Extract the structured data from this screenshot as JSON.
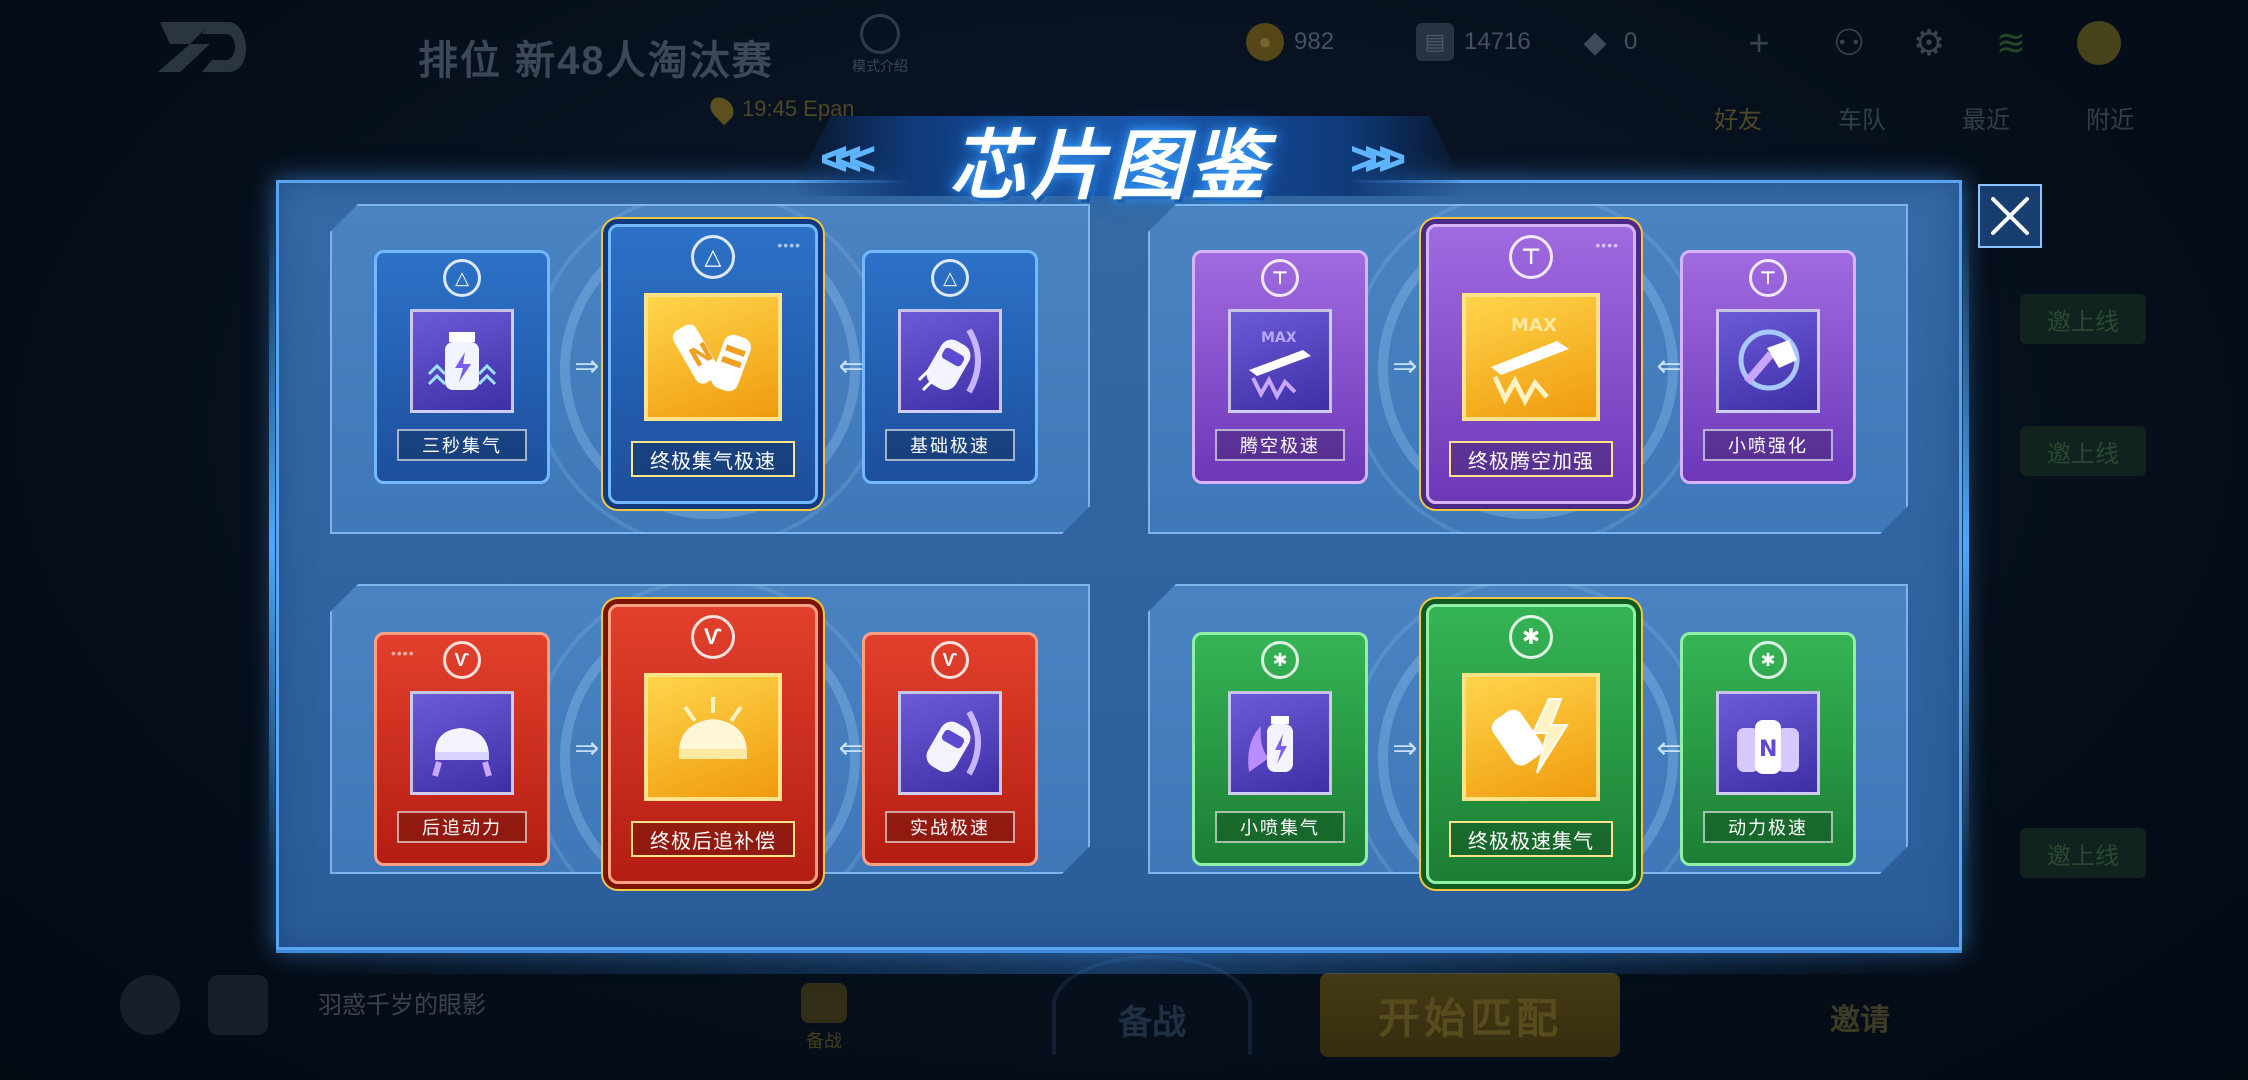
{
  "lobby": {
    "mode_title": "排位 新48人淘汰赛",
    "mode_icon_label": "模式介绍",
    "location_text": "19:45 Epan",
    "resources": [
      {
        "icon": "coin-icon",
        "value": "982"
      },
      {
        "icon": "ticket-icon",
        "value": "14716"
      },
      {
        "icon": "gem-icon",
        "value": "0"
      }
    ],
    "social_tabs": [
      "好友",
      "车队",
      "最近",
      "附近"
    ],
    "online_buttons": [
      "邀上线",
      "邀上线",
      "邀上线"
    ],
    "bottom": {
      "player_name": "羽惑千岁的眼影",
      "prep_label": "备战",
      "fight_label": "备战",
      "start_label": "开始匹配",
      "invite_label": "邀请"
    }
  },
  "modal": {
    "title": "芯片图鉴",
    "close_icon": "close-icon",
    "groups": [
      {
        "color": "blue",
        "emblem": "triangle-emblem-icon",
        "left": {
          "label": "三秒集气",
          "icon": "nitro-bottle-icon"
        },
        "center": {
          "label": "终极集气极速",
          "icon": "nitro-bottles-icon"
        },
        "right": {
          "label": "基础极速",
          "icon": "speed-car-icon"
        }
      },
      {
        "color": "purple",
        "emblem": "wing-emblem-icon",
        "left": {
          "label": "腾空极速",
          "icon": "flying-car-icon"
        },
        "center": {
          "label": "终极腾空加强",
          "icon": "max-flying-car-icon"
        },
        "right": {
          "label": "小喷强化",
          "icon": "jet-boost-icon"
        }
      },
      {
        "color": "red",
        "emblem": "horn-emblem-icon",
        "left": {
          "label": "后追动力",
          "icon": "rear-car-icon"
        },
        "center": {
          "label": "终极后追补偿",
          "icon": "rear-boost-car-icon"
        },
        "right": {
          "label": "实战极速",
          "icon": "drift-car-icon"
        }
      },
      {
        "color": "green",
        "emblem": "gear-emblem-icon",
        "left": {
          "label": "小喷集气",
          "icon": "flame-bottle-icon"
        },
        "center": {
          "label": "终极极速集气",
          "icon": "lightning-jet-icon"
        },
        "right": {
          "label": "动力极速",
          "icon": "n-bottles-icon"
        }
      }
    ]
  }
}
